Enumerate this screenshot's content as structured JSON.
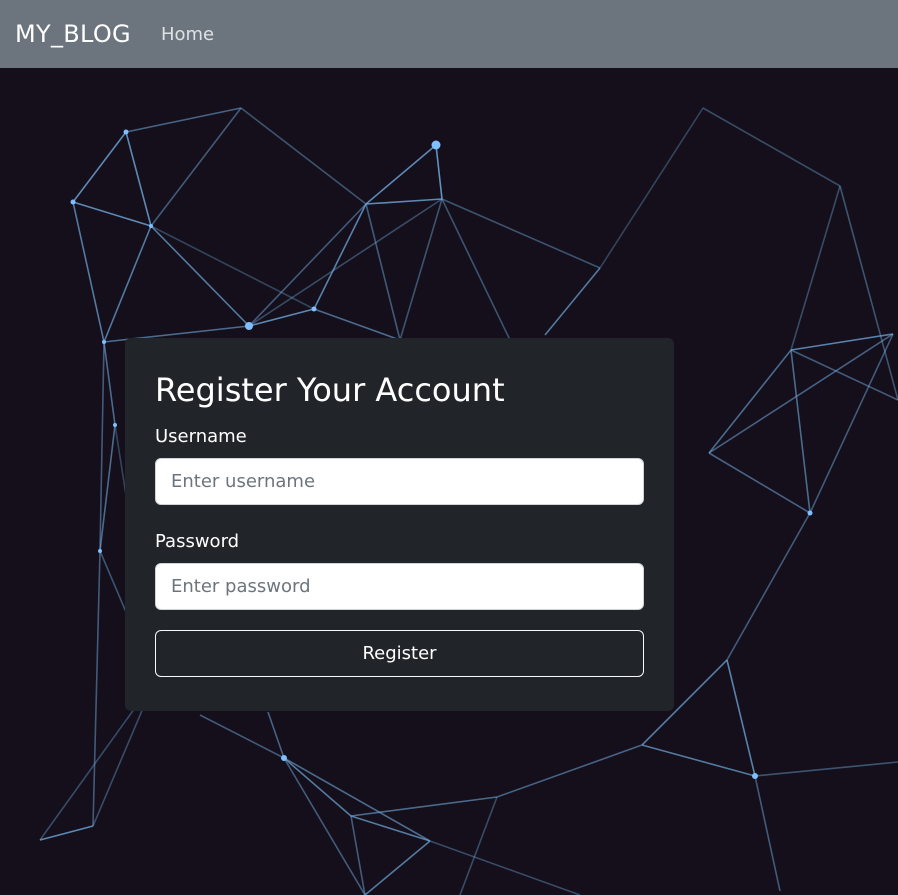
{
  "navbar": {
    "brand": "MY_BLOG",
    "links": [
      {
        "label": "Home"
      }
    ]
  },
  "register_card": {
    "title": "Register Your Account",
    "username": {
      "label": "Username",
      "placeholder": "Enter username",
      "value": ""
    },
    "password": {
      "label": "Password",
      "placeholder": "Enter password",
      "value": ""
    },
    "submit_label": "Register"
  },
  "colors": {
    "navbar_bg": "#6c757d",
    "page_bg": "#140f1a",
    "card_bg": "#212529",
    "network_line": "#6fa8dc",
    "network_node": "#7fbfff"
  }
}
